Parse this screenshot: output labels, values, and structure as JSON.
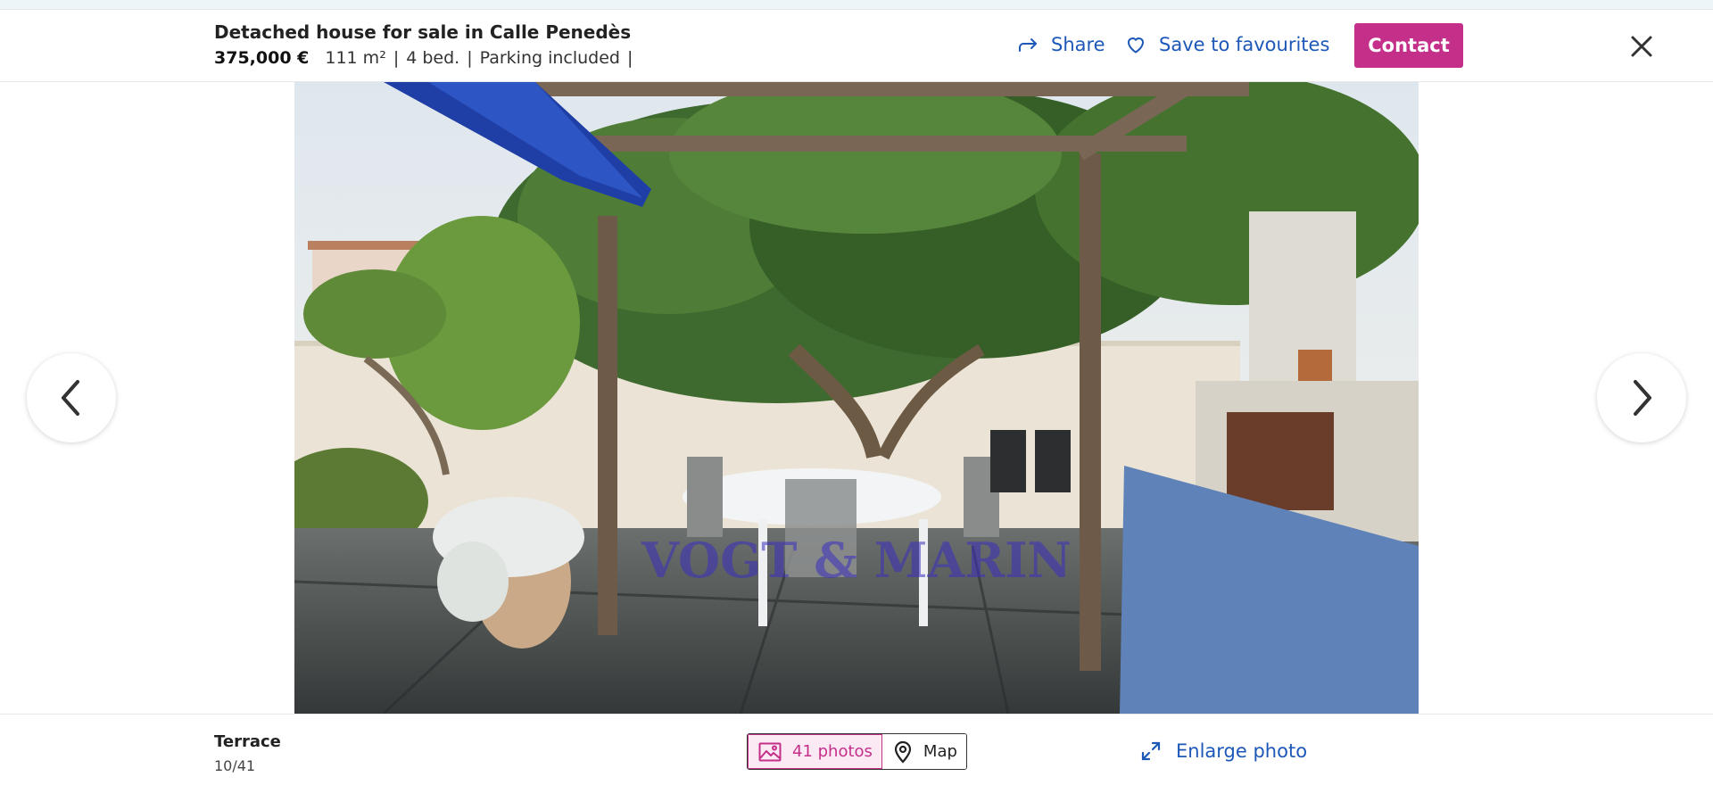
{
  "header": {
    "title": "Detached house for sale in Calle Penedès",
    "price": "375,000 €",
    "area": "111 m²",
    "bedrooms": "4 bed.",
    "parking": "Parking included",
    "separator": "|",
    "share_label": "Share",
    "save_label": "Save to favourites",
    "contact_label": "Contact"
  },
  "photo": {
    "caption": "Terrace",
    "counter": "10/41",
    "watermark": "VOGT & MARIN"
  },
  "footer": {
    "photos_label": "41 photos",
    "map_label": "Map",
    "enlarge_label": "Enlarge photo"
  },
  "colors": {
    "accent": "#c42f8a",
    "link": "#1d58b8"
  },
  "icons": [
    "share-icon",
    "heart-icon",
    "close-icon",
    "chevron-left-icon",
    "chevron-right-icon",
    "image-icon",
    "map-pin-icon",
    "expand-icon"
  ]
}
